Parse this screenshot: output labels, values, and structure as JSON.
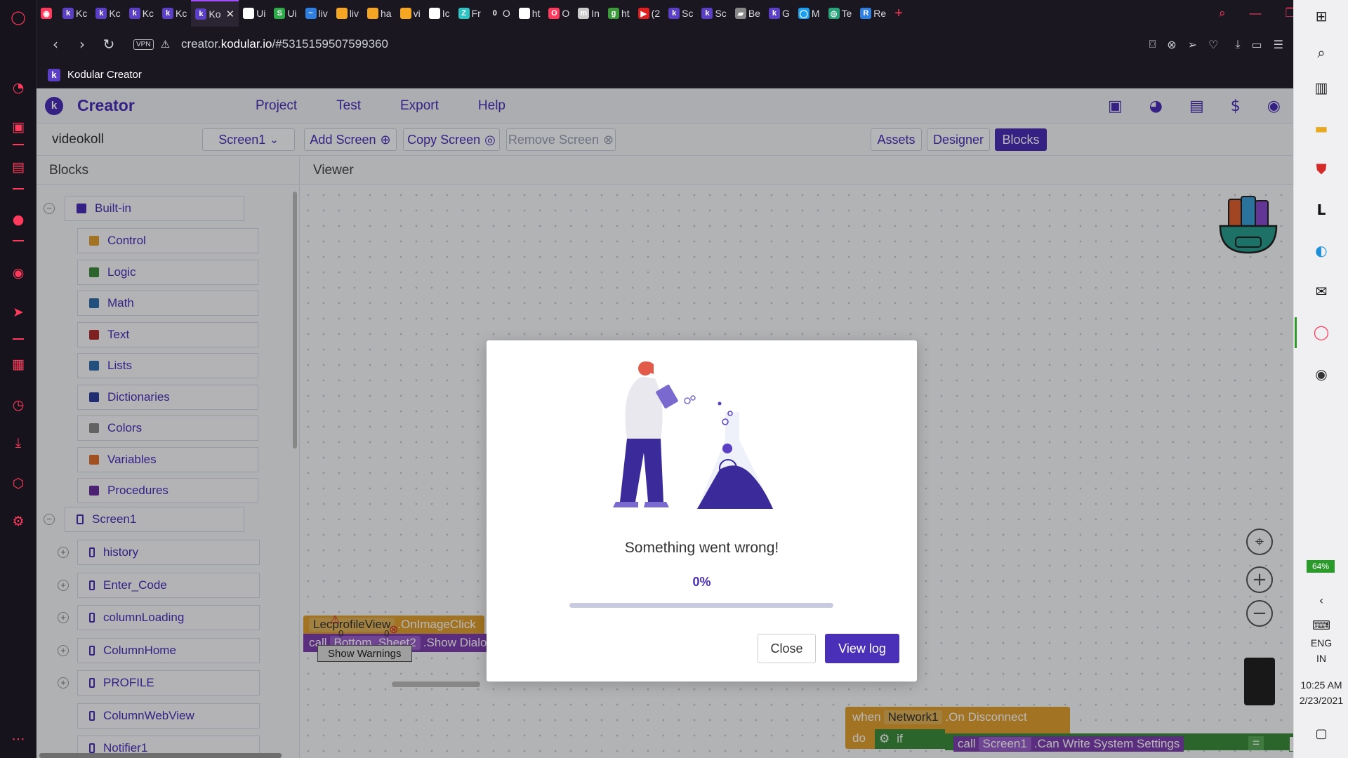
{
  "browser": {
    "tabs": [
      {
        "label": "",
        "fav_color": "#ff3a5c",
        "fav_char": "◉"
      },
      {
        "label": "Kc",
        "fav_color": "#5b3fc4",
        "fav_char": "k"
      },
      {
        "label": "Kc",
        "fav_color": "#5b3fc4",
        "fav_char": "k"
      },
      {
        "label": "Kc",
        "fav_color": "#5b3fc4",
        "fav_char": "k"
      },
      {
        "label": "Kc",
        "fav_color": "#5b3fc4",
        "fav_char": "k"
      },
      {
        "label": "Ko",
        "fav_color": "#5b3fc4",
        "fav_char": "k",
        "active": true
      },
      {
        "label": "Ui",
        "fav_color": "#ffffff",
        "fav_char": ""
      },
      {
        "label": "Ui",
        "fav_color": "#2eaa4a",
        "fav_char": "S"
      },
      {
        "label": "liv",
        "fav_color": "#2f7fe0",
        "fav_char": "~"
      },
      {
        "label": "liv",
        "fav_color": "#f5a623",
        "fav_char": ""
      },
      {
        "label": "ha",
        "fav_color": "#f5a623",
        "fav_char": ""
      },
      {
        "label": "vi",
        "fav_color": "#f5a623",
        "fav_char": ""
      },
      {
        "label": "Ic",
        "fav_color": "#ffffff",
        "fav_char": ""
      },
      {
        "label": "Fr",
        "fav_color": "#2ec4c4",
        "fav_char": "Z"
      },
      {
        "label": "O",
        "fav_color": "#1a1720",
        "fav_char": "0"
      },
      {
        "label": "ht",
        "fav_color": "#ffffff",
        "fav_char": ""
      },
      {
        "label": "O",
        "fav_color": "#ff3a5c",
        "fav_char": "O"
      },
      {
        "label": "In",
        "fav_color": "#cccccc",
        "fav_char": "m"
      },
      {
        "label": "ht",
        "fav_color": "#3c9a3c",
        "fav_char": "g"
      },
      {
        "label": "(2",
        "fav_color": "#e02020",
        "fav_char": "▶"
      },
      {
        "label": "Sc",
        "fav_color": "#5b3fc4",
        "fav_char": "k"
      },
      {
        "label": "Sc",
        "fav_color": "#5b3fc4",
        "fav_char": "k"
      },
      {
        "label": "Be",
        "fav_color": "#888888",
        "fav_char": "▰"
      },
      {
        "label": "G",
        "fav_color": "#5b3fc4",
        "fav_char": "k"
      },
      {
        "label": "M",
        "fav_color": "#1a9ff0",
        "fav_char": "◯"
      },
      {
        "label": "Te",
        "fav_color": "#2aa37a",
        "fav_char": "◎"
      },
      {
        "label": "Re",
        "fav_color": "#2f7fe0",
        "fav_char": "R"
      }
    ],
    "new_tab": "+",
    "url_prefix": "creator.",
    "url_domain": "kodular.io",
    "url_rest": "/#5315159507599360",
    "vpn": "VPN",
    "bookmark_label": "Kodular Creator"
  },
  "app": {
    "brand": "Creator",
    "menu": [
      "Project",
      "Test",
      "Export",
      "Help"
    ],
    "project_name": "videokoll",
    "screen_select": "Screen1",
    "add_screen": "Add Screen",
    "copy_screen": "Copy Screen",
    "remove_screen": "Remove Screen",
    "assets": "Assets",
    "designer": "Designer",
    "blocks": "Blocks",
    "blocks_panel_title": "Blocks",
    "viewer_title": "Viewer",
    "builtin_label": "Built-in",
    "builtin_items": [
      {
        "label": "Control",
        "color": "#e0a030"
      },
      {
        "label": "Logic",
        "color": "#3c8c3c"
      },
      {
        "label": "Math",
        "color": "#2f6fb0"
      },
      {
        "label": "Text",
        "color": "#b02f2f"
      },
      {
        "label": "Lists",
        "color": "#2f6fb0"
      },
      {
        "label": "Dictionaries",
        "color": "#2f3fa0"
      },
      {
        "label": "Colors",
        "color": "#888888"
      },
      {
        "label": "Variables",
        "color": "#e07030"
      },
      {
        "label": "Procedures",
        "color": "#6a2fa0"
      }
    ],
    "screen_label": "Screen1",
    "components": [
      "history",
      "Enter_Code",
      "columnLoading",
      "ColumnHome",
      "PROFILE",
      "ColumnWebView",
      "Notifier1"
    ],
    "blocks_canvas": {
      "event_component": "LecprofileView",
      "event_name": ".OnImageClick",
      "call": "call",
      "call_component": "Bottom_Sheet2",
      "call_method": ".Show Dialog",
      "warn_count": "0",
      "error_count": "0",
      "show_warnings": "Show Warnings",
      "when": "when",
      "network_component": "Network1",
      "network_event": ".On Disconnect",
      "do": "do",
      "if": "if",
      "call2": "call",
      "screen_component": "Screen1",
      "screen_method": ".Can Write System Settings",
      "eq": "=",
      "false_value": "false"
    }
  },
  "dialog": {
    "message": "Something went wrong!",
    "percent_label": "0%",
    "progress_fraction": 0,
    "close": "Close",
    "view_log": "View log"
  },
  "taskbar": {
    "battery": "64%",
    "lang": "ENG",
    "region": "IN",
    "time": "10:25 AM",
    "date": "2/23/2021"
  }
}
